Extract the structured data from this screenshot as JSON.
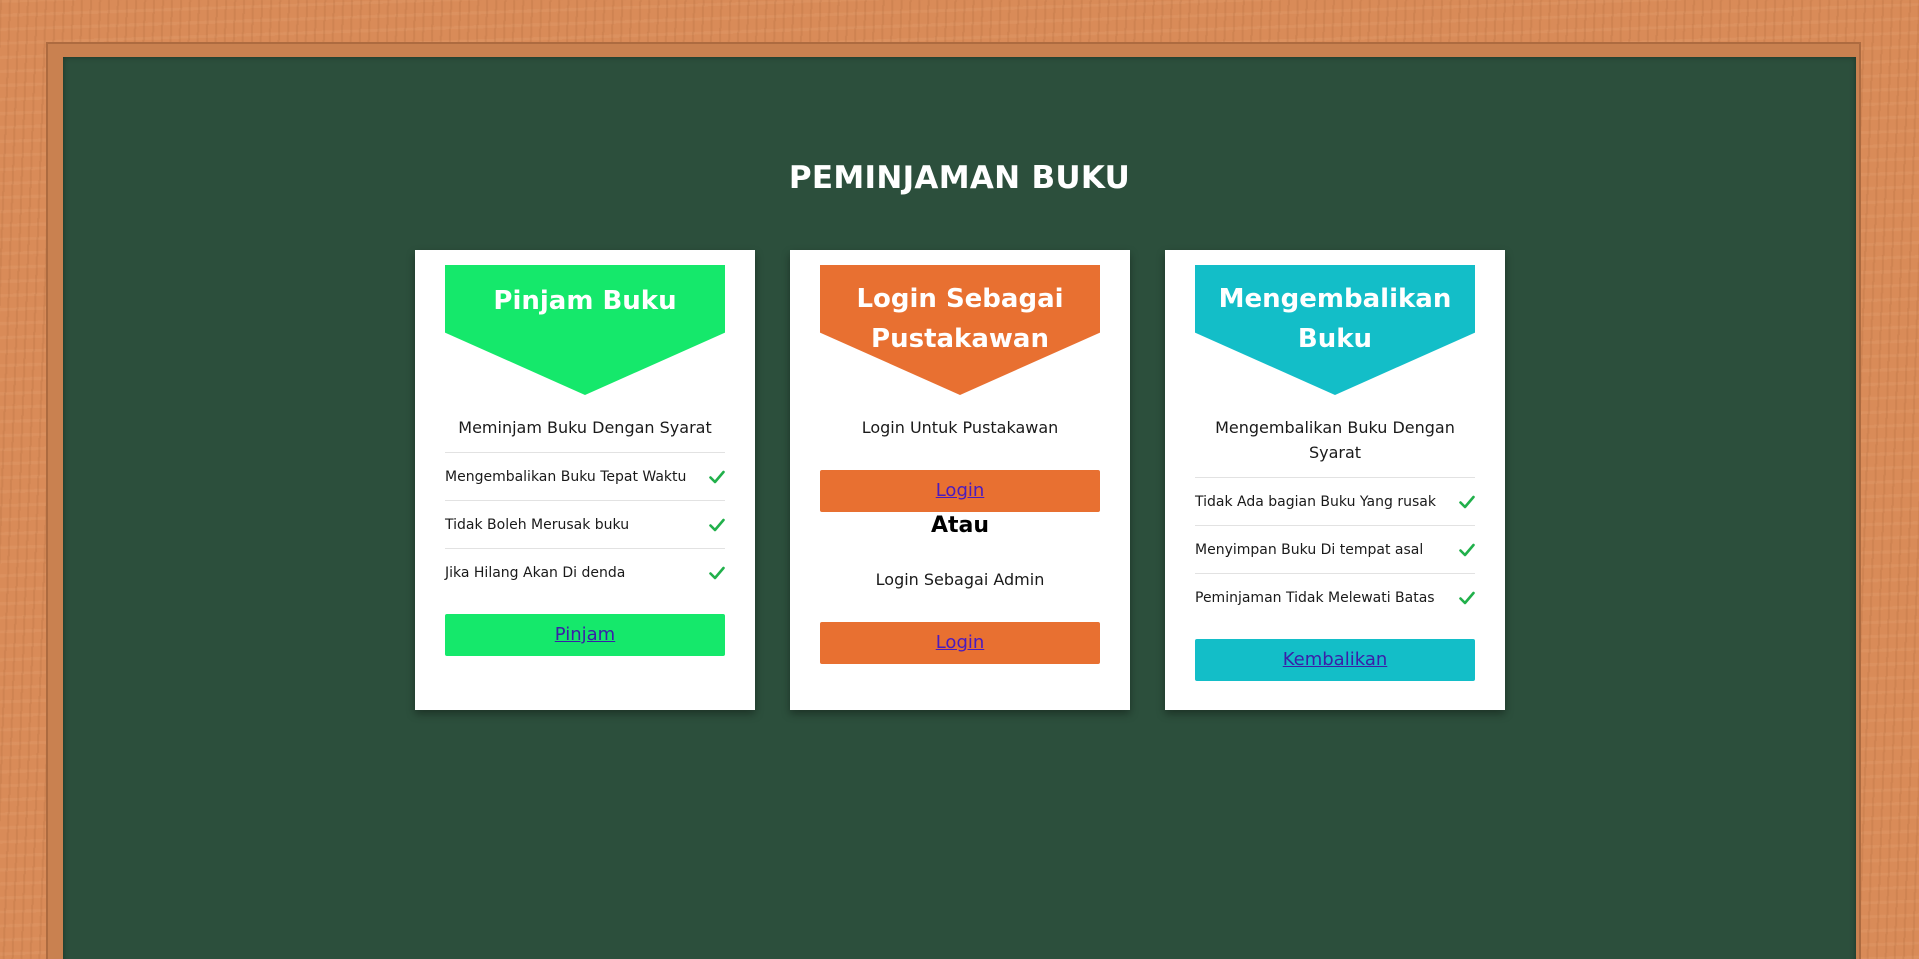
{
  "page": {
    "title": "PEMINJAMAN BUKU"
  },
  "colors": {
    "board": "#2c4f3c",
    "frame": "#d98b58",
    "green": "#15e86b",
    "orange": "#e87031",
    "teal": "#13bec8",
    "check": "#21b04b"
  },
  "cards": [
    {
      "header": "Pinjam Buku",
      "subtitle": "Meminjam Buku Dengan Syarat",
      "items": [
        {
          "label": "Mengembalikan Buku Tepat Waktu",
          "icon": "check-icon"
        },
        {
          "label": "Tidak Boleh Merusak buku",
          "icon": "check-icon"
        },
        {
          "label": "Jika Hilang Akan Di denda",
          "icon": "check-icon"
        }
      ],
      "button": "Pinjam"
    },
    {
      "header_line1": "Login Sebagai",
      "header_line2": "Pustakawan",
      "subtitle": "Login Untuk Pustakawan",
      "button1": "Login",
      "divider_text": "Atau",
      "subtitle2": "Login Sebagai Admin",
      "button2": "Login"
    },
    {
      "header_line1": "Mengembalikan",
      "header_line2": "Buku",
      "subtitle_line1": "Mengembalikan Buku Dengan",
      "subtitle_line2": "Syarat",
      "items": [
        {
          "label": "Tidak Ada bagian Buku Yang rusak",
          "icon": "check-icon"
        },
        {
          "label": "Menyimpan Buku Di tempat asal",
          "icon": "check-icon"
        },
        {
          "label": "Peminjaman Tidak Melewati Batas",
          "icon": "check-icon"
        }
      ],
      "button": "Kembalikan"
    }
  ]
}
